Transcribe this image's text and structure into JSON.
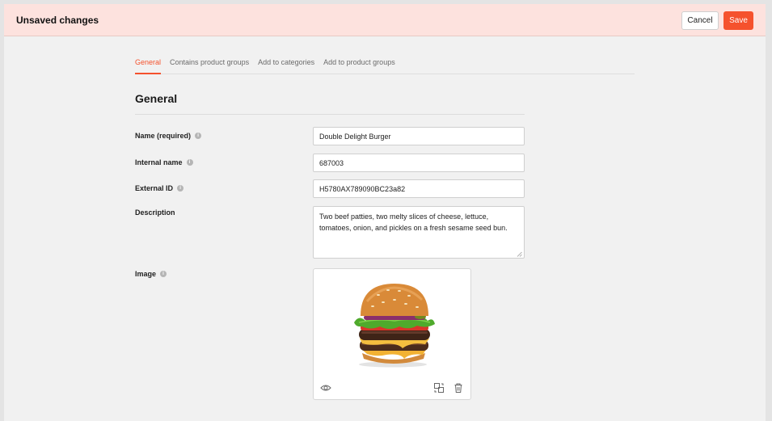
{
  "header": {
    "title": "Unsaved changes",
    "cancel_label": "Cancel",
    "save_label": "Save"
  },
  "tabs": [
    {
      "label": "General",
      "active": true
    },
    {
      "label": "Contains product groups",
      "active": false
    },
    {
      "label": "Add to categories",
      "active": false
    },
    {
      "label": "Add to product groups",
      "active": false
    }
  ],
  "section": {
    "title": "General"
  },
  "form": {
    "name": {
      "label": "Name (required)",
      "value": "Double Delight Burger"
    },
    "internal_name": {
      "label": "Internal name",
      "value": "687003"
    },
    "external_id": {
      "label": "External ID",
      "value": "H5780AX789090BC23a82"
    },
    "description": {
      "label": "Description",
      "value": "Two beef patties, two melty slices of cheese, lettuce, tomatoes, onion, and pickles on a fresh sesame seed bun."
    },
    "image": {
      "label": "Image"
    }
  },
  "icons": {
    "info": "info-icon",
    "view": "eye-icon",
    "replace": "replace-image-icon",
    "delete": "trash-icon"
  },
  "colors": {
    "accent": "#f5522d",
    "banner": "#fde2de"
  }
}
